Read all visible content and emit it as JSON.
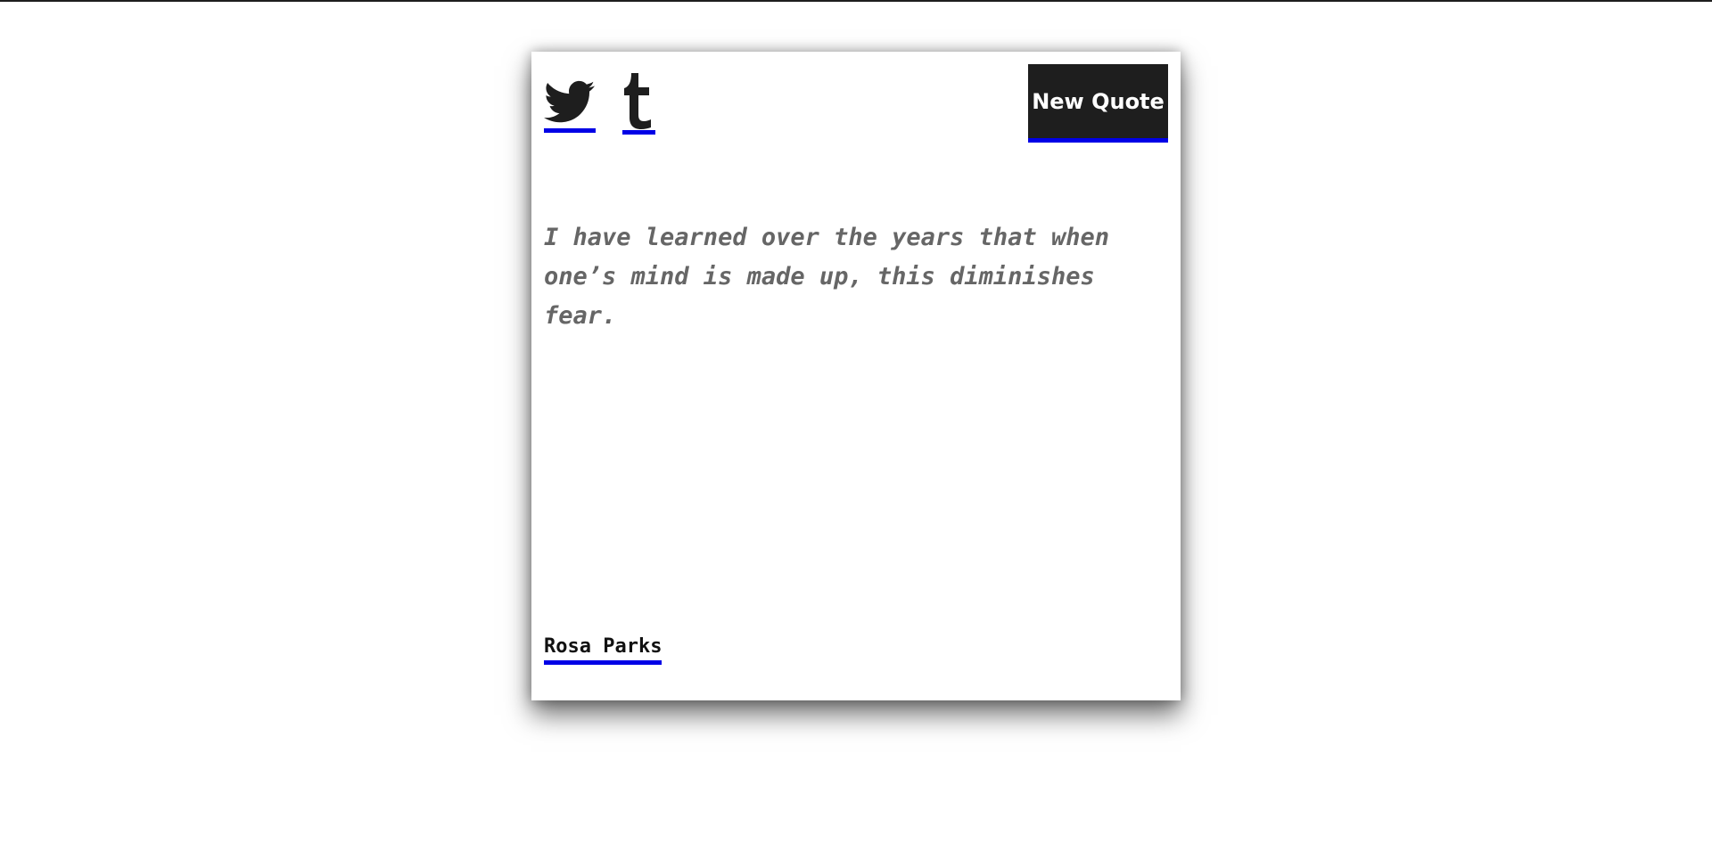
{
  "share": {
    "twitter_icon": "twitter-bird-icon",
    "tumblr_icon": "tumblr-t-icon"
  },
  "toolbar": {
    "new_quote_label": "New Quote"
  },
  "quote": {
    "text": "I have learned over the years that when one’s mind is made up, this diminishes fear.",
    "author": "Rosa Parks"
  },
  "colors": {
    "accent_underline": "#0000e6",
    "button_bg": "#1e1e1e",
    "quote_text": "#666666"
  }
}
